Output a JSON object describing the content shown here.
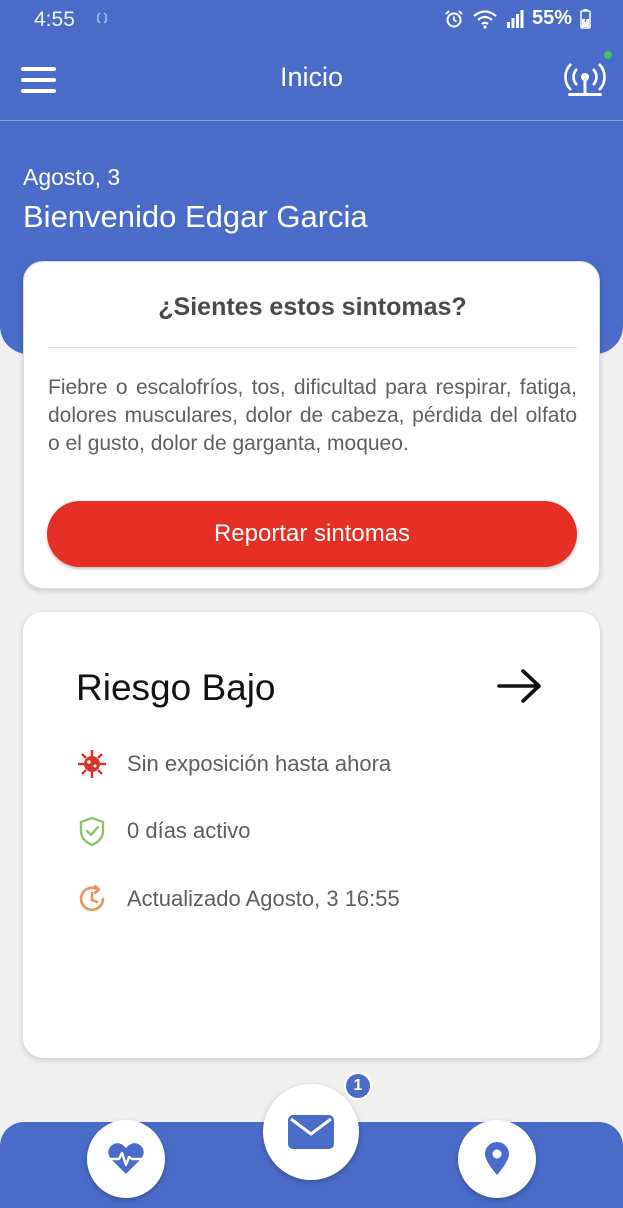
{
  "status_bar": {
    "time": "4:55",
    "battery": "55%"
  },
  "app_bar": {
    "title": "Inicio"
  },
  "greeting": {
    "date": "Agosto, 3",
    "name": "Bienvenido Edgar Garcia"
  },
  "symptom_card": {
    "title": "¿Sientes estos sintomas?",
    "description": "Fiebre o escalofríos, tos, dificultad para respirar, fatiga, dolores musculares, dolor de cabeza, pérdida del olfato o el gusto, dolor de garganta, moqueo.",
    "button_label": "Reportar sintomas"
  },
  "risk_card": {
    "title": "Riesgo Bajo",
    "items": [
      {
        "icon": "virus-icon",
        "text": "Sin exposición hasta ahora"
      },
      {
        "icon": "shield-check-icon",
        "text": "0 días activo"
      },
      {
        "icon": "clock-refresh-icon",
        "text": "Actualizado Agosto, 3 16:55"
      }
    ]
  },
  "bottom_nav": {
    "items": [
      {
        "icon": "heart-pulse-icon"
      },
      {
        "icon": "mail-icon",
        "badge": "1"
      },
      {
        "icon": "location-pin-icon"
      }
    ]
  },
  "colors": {
    "primary": "#4a6cc9",
    "danger": "#e52f25",
    "success": "#43c463",
    "warning": "#e8955a",
    "virus": "#d9342b",
    "shield": "#8ac56a"
  }
}
